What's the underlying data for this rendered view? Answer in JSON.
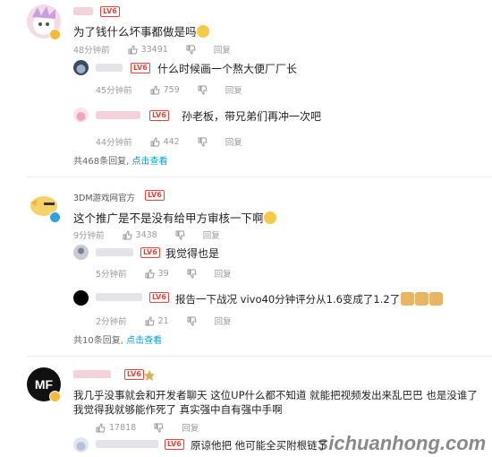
{
  "comments": [
    {
      "text": "为了钱什么坏事都做是吗",
      "time": "48分钟前",
      "likes": "33491",
      "reply_label": "回复",
      "replies": [
        {
          "text": "什么时候画一个熬大便厂厂长",
          "time": "45分钟前",
          "likes": "759",
          "reply_label": "回复"
        },
        {
          "text": "孙老板，带兄弟们再冲一次吧",
          "time": "44分钟前",
          "likes": "442",
          "reply_label": "回复"
        }
      ],
      "summary_count": "共468条回复,",
      "summary_link": "点击查看"
    },
    {
      "username": "3DM游戏网官方",
      "text": "这个推广是不是没有给甲方审核一下啊",
      "time": "9分钟前",
      "likes": "3438",
      "reply_label": "回复",
      "replies": [
        {
          "text": "我觉得也是",
          "time": "5分钟前",
          "likes": "39",
          "reply_label": "回复"
        },
        {
          "text": "报告一下战况 vivo40分钟评分从1.6变成了1.2了",
          "time": "2分钟前",
          "likes": "21",
          "reply_label": "回复"
        }
      ],
      "summary_count": "共10条回复,",
      "summary_link": "点击查看"
    },
    {
      "text_line1": "我几乎没事就会和开发者聊天   这位UP什么都不知道 就能把视频发出来乱巴巴   也是没谁了",
      "text_line2": "我觉得我就够能作死了  真实强中自有强中手啊",
      "likes": "17818",
      "reply_label": "回复",
      "replies": [
        {
          "text": "原谅他把 他可能全买附根链了"
        }
      ]
    }
  ],
  "level_badge": "LV6",
  "avatar_mf": "MF",
  "watermark": "sichuanhong.com",
  "colors": {
    "link": "#00a1d6",
    "level": "#e8443b"
  }
}
